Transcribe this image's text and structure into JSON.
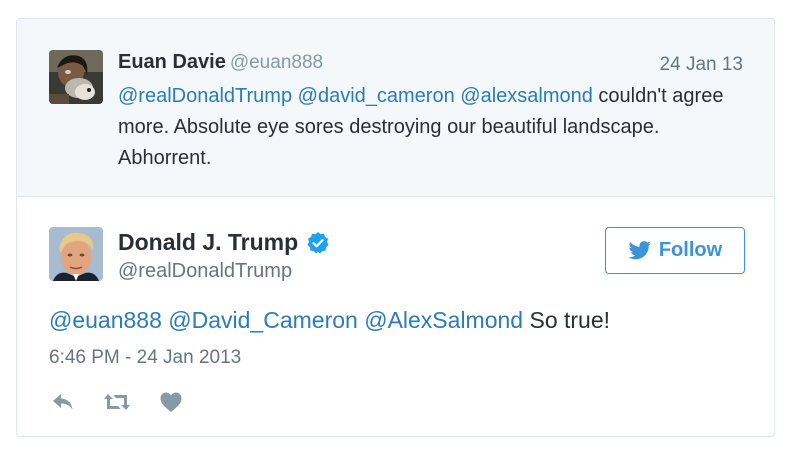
{
  "parent_tweet": {
    "author_name": "Euan Davie",
    "author_handle": "@euan888",
    "date": "24 Jan 13",
    "mentions": [
      "@realDonaldTrump",
      "@david_cameron",
      "@alexsalmond"
    ],
    "text": "couldn't agree more. Absolute eye sores destroying our beautiful landscape. Abhorrent."
  },
  "tweet": {
    "author_name": "Donald J. Trump",
    "author_handle": "@realDonaldTrump",
    "verified": true,
    "follow_label": "Follow",
    "mentions": [
      "@euan888",
      "@David_Cameron",
      "@AlexSalmond"
    ],
    "text": "So true!",
    "timestamp": "6:46 PM - 24 Jan 2013"
  },
  "actions": {
    "icons": [
      "reply-icon",
      "retweet-icon",
      "like-icon"
    ]
  },
  "colors": {
    "link": "#2b7bb9",
    "follow": "#3b94d9",
    "verified": "#1da1f2",
    "muted": "#66757f",
    "parent_bg": "#f5f8fa"
  }
}
